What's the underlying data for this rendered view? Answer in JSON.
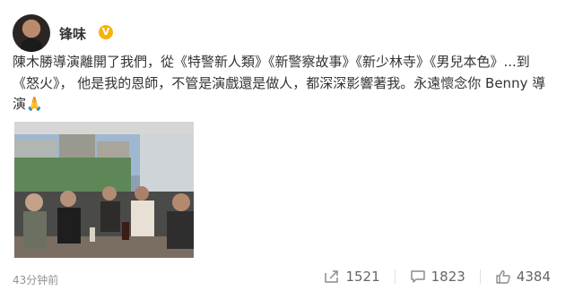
{
  "post": {
    "author": "锋味",
    "verified_badge": "V",
    "text": "陳木勝導演離開了我們，從《特警新人類》《新警察故事》《新少林寺》《男兒本色》...到《怒火》， 他是我的恩師，不管是演戲還是做人，都深深影響著我。永遠懷念你 Benny 導演",
    "emoji": "🙏",
    "timestamp": "43分钟前"
  },
  "actions": {
    "share_count": "1521",
    "comment_count": "1823",
    "like_count": "4384"
  },
  "icons": [
    "avatar",
    "verified-badge-icon",
    "share-icon",
    "comment-icon",
    "like-icon"
  ],
  "colors": {
    "verified": "#f6b30c",
    "text": "#333333",
    "meta": "#939393"
  }
}
